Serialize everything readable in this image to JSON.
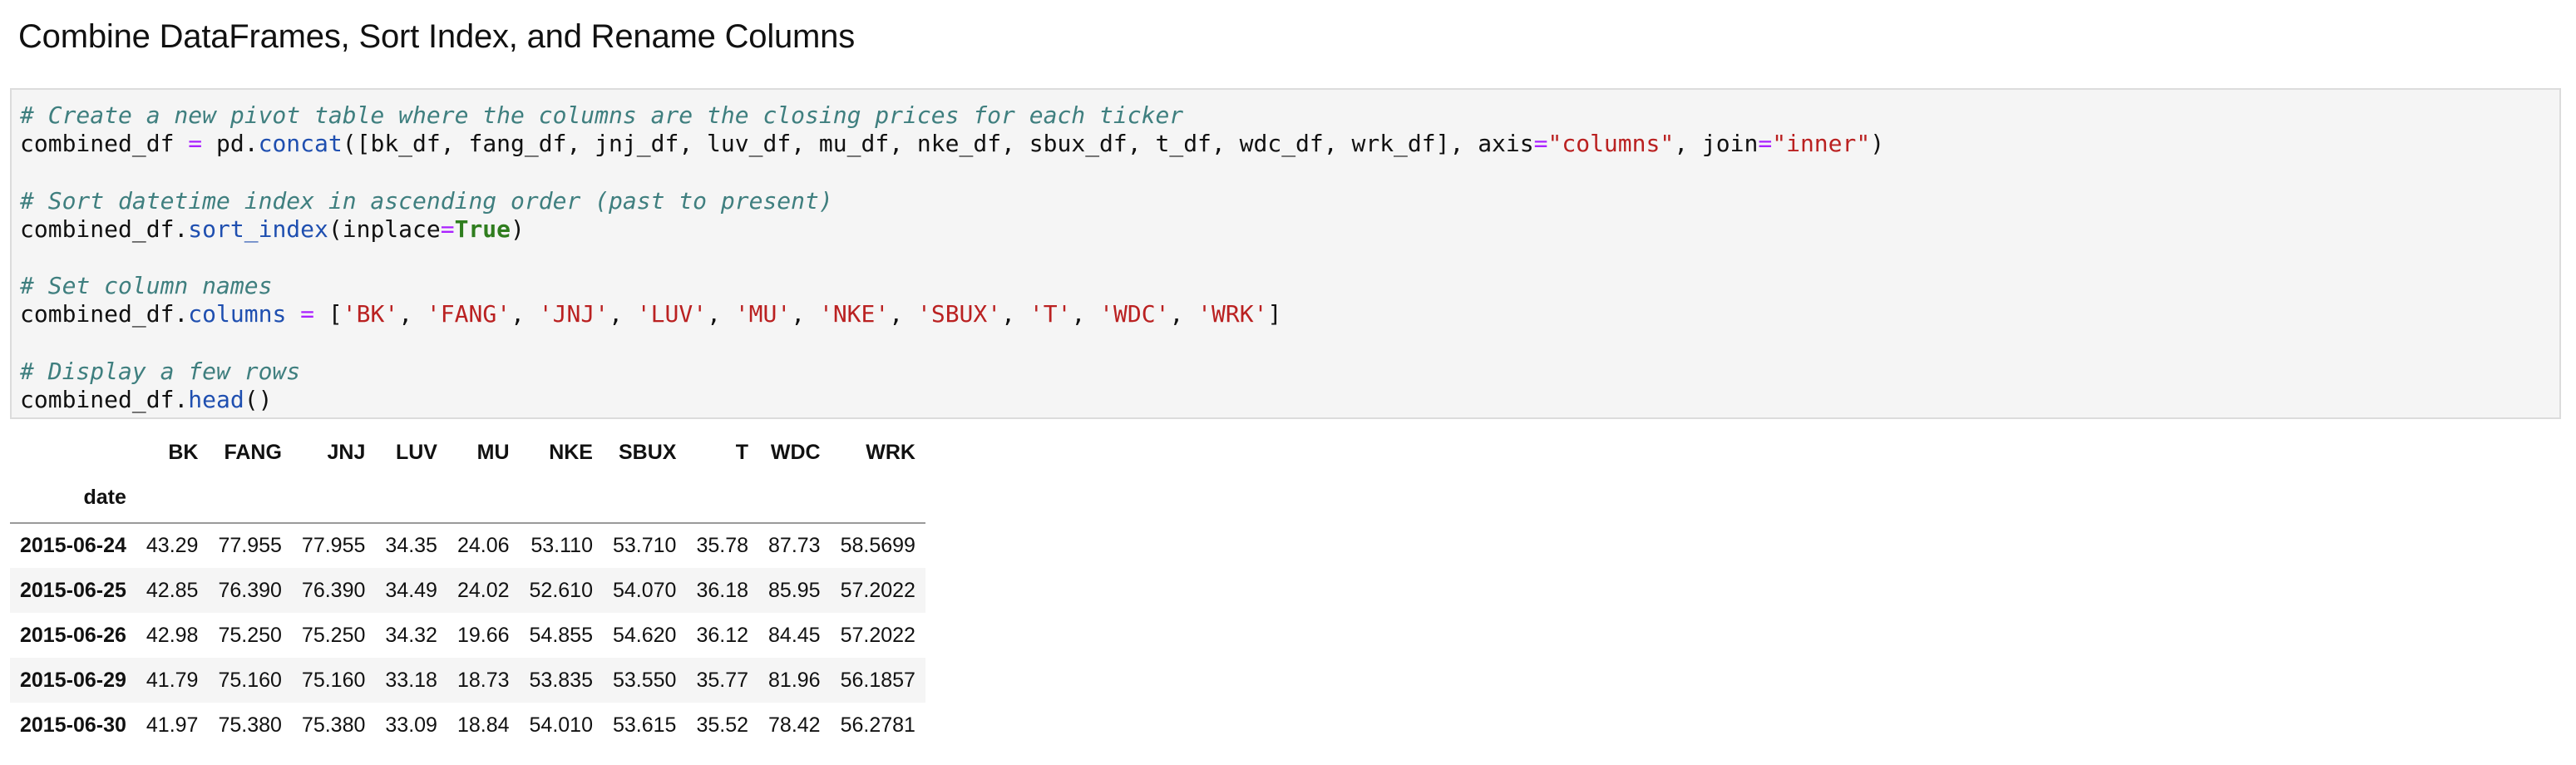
{
  "heading": "Combine DataFrames, Sort Index, and Rename Columns",
  "code": {
    "lines": [
      [
        {
          "t": "# Create a new pivot table where the columns are the closing prices for each ticker",
          "c": "comment"
        }
      ],
      [
        {
          "t": "combined_df ",
          "c": "txt"
        },
        {
          "t": "=",
          "c": "op"
        },
        {
          "t": " pd.",
          "c": "txt"
        },
        {
          "t": "concat",
          "c": "fn"
        },
        {
          "t": "([bk_df, fang_df, jnj_df, luv_df, mu_df, nke_df, sbux_df, t_df, wdc_df, wrk_df], axis",
          "c": "txt"
        },
        {
          "t": "=",
          "c": "op"
        },
        {
          "t": "\"columns\"",
          "c": "str"
        },
        {
          "t": ", join",
          "c": "txt"
        },
        {
          "t": "=",
          "c": "op"
        },
        {
          "t": "\"inner\"",
          "c": "str"
        },
        {
          "t": ")",
          "c": "txt"
        }
      ],
      [],
      [
        {
          "t": "# Sort datetime index in ascending order (past to present)",
          "c": "comment"
        }
      ],
      [
        {
          "t": "combined_df.",
          "c": "txt"
        },
        {
          "t": "sort_index",
          "c": "fn"
        },
        {
          "t": "(inplace",
          "c": "txt"
        },
        {
          "t": "=",
          "c": "op"
        },
        {
          "t": "True",
          "c": "kw"
        },
        {
          "t": ")",
          "c": "txt"
        }
      ],
      [],
      [
        {
          "t": "# Set column names",
          "c": "comment"
        }
      ],
      [
        {
          "t": "combined_df.",
          "c": "txt"
        },
        {
          "t": "columns",
          "c": "fn"
        },
        {
          "t": " ",
          "c": "txt"
        },
        {
          "t": "=",
          "c": "op"
        },
        {
          "t": " [",
          "c": "txt"
        },
        {
          "t": "'BK'",
          "c": "str"
        },
        {
          "t": ", ",
          "c": "txt"
        },
        {
          "t": "'FANG'",
          "c": "str"
        },
        {
          "t": ", ",
          "c": "txt"
        },
        {
          "t": "'JNJ'",
          "c": "str"
        },
        {
          "t": ", ",
          "c": "txt"
        },
        {
          "t": "'LUV'",
          "c": "str"
        },
        {
          "t": ", ",
          "c": "txt"
        },
        {
          "t": "'MU'",
          "c": "str"
        },
        {
          "t": ", ",
          "c": "txt"
        },
        {
          "t": "'NKE'",
          "c": "str"
        },
        {
          "t": ", ",
          "c": "txt"
        },
        {
          "t": "'SBUX'",
          "c": "str"
        },
        {
          "t": ", ",
          "c": "txt"
        },
        {
          "t": "'T'",
          "c": "str"
        },
        {
          "t": ", ",
          "c": "txt"
        },
        {
          "t": "'WDC'",
          "c": "str"
        },
        {
          "t": ", ",
          "c": "txt"
        },
        {
          "t": "'WRK'",
          "c": "str"
        },
        {
          "t": "]",
          "c": "txt"
        }
      ],
      [],
      [
        {
          "t": "# Display a few rows",
          "c": "comment"
        }
      ],
      [
        {
          "t": "combined_df.",
          "c": "txt"
        },
        {
          "t": "head",
          "c": "fn"
        },
        {
          "t": "()",
          "c": "txt"
        }
      ]
    ]
  },
  "table": {
    "columns": [
      "BK",
      "FANG",
      "JNJ",
      "LUV",
      "MU",
      "NKE",
      "SBUX",
      "T",
      "WDC",
      "WRK"
    ],
    "index_name": "date",
    "rows": [
      {
        "date": "2015-06-24",
        "values": [
          "43.29",
          "77.955",
          "77.955",
          "34.35",
          "24.06",
          "53.110",
          "53.710",
          "35.78",
          "87.73",
          "58.5699"
        ]
      },
      {
        "date": "2015-06-25",
        "values": [
          "42.85",
          "76.390",
          "76.390",
          "34.49",
          "24.02",
          "52.610",
          "54.070",
          "36.18",
          "85.95",
          "57.2022"
        ]
      },
      {
        "date": "2015-06-26",
        "values": [
          "42.98",
          "75.250",
          "75.250",
          "34.32",
          "19.66",
          "54.855",
          "54.620",
          "36.12",
          "84.45",
          "57.2022"
        ]
      },
      {
        "date": "2015-06-29",
        "values": [
          "41.79",
          "75.160",
          "75.160",
          "33.18",
          "18.73",
          "53.835",
          "53.550",
          "35.77",
          "81.96",
          "56.1857"
        ]
      },
      {
        "date": "2015-06-30",
        "values": [
          "41.97",
          "75.380",
          "75.380",
          "33.09",
          "18.84",
          "54.010",
          "53.615",
          "35.52",
          "78.42",
          "56.2781"
        ]
      }
    ]
  }
}
